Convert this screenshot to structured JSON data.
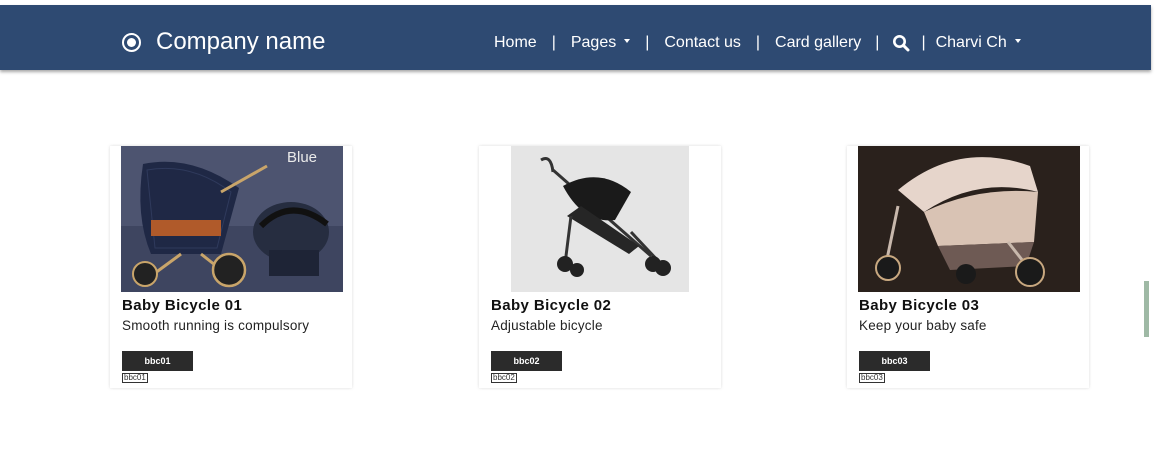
{
  "navbar": {
    "brand": "Company name",
    "items": {
      "home": "Home",
      "pages": "Pages",
      "contact": "Contact us",
      "gallery": "Card gallery",
      "user": "Charvi Ch"
    },
    "separator": "|"
  },
  "colors": {
    "navbar_bg": "#2e4a72",
    "button_bg": "#2b2b2b",
    "scroll_indicator": "#9fb9a5"
  },
  "cards": [
    {
      "title": "Baby Bicycle 01",
      "description": "Smooth running is compulsory",
      "button": "bbc01",
      "tag": "bbc01",
      "image_label": "Blue"
    },
    {
      "title": "Baby Bicycle 02",
      "description": "Adjustable bicycle",
      "button": "bbc02",
      "tag": "bbc02"
    },
    {
      "title": "Baby Bicycle 03",
      "description": "Keep your baby safe",
      "button": "bbc03",
      "tag": "bbc03"
    }
  ]
}
